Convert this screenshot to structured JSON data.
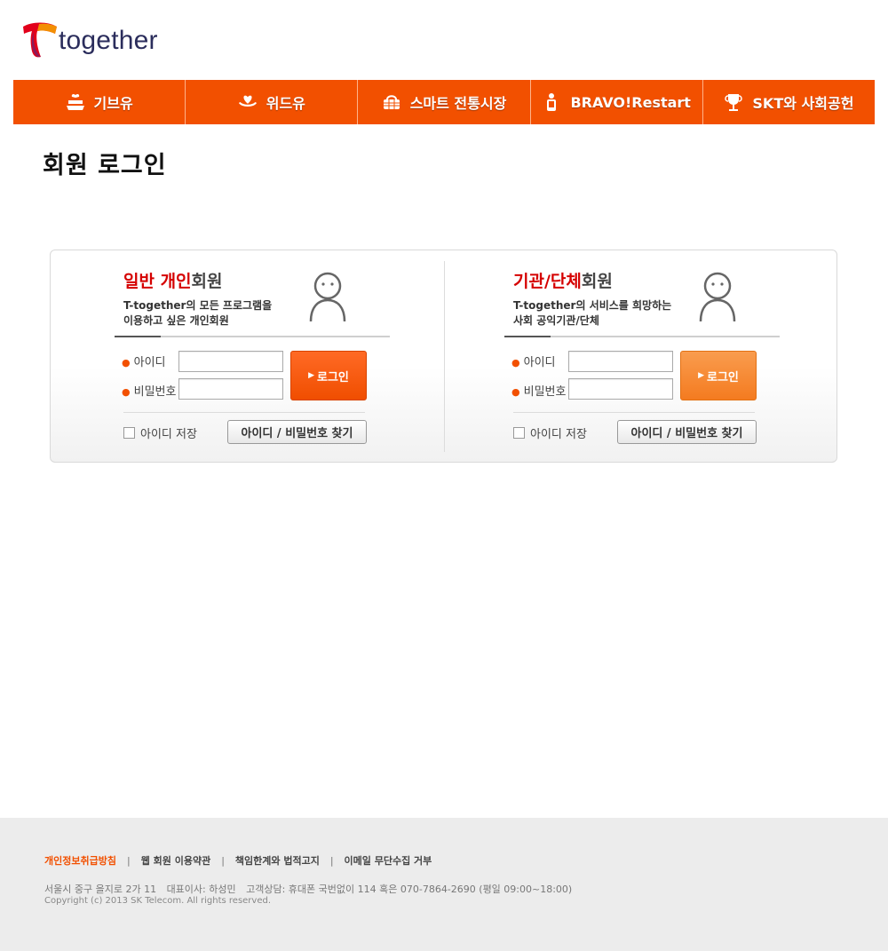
{
  "brand": {
    "logo_text": "together",
    "colors": {
      "primary": "#f25000",
      "logo_red": "#e2001a",
      "logo_yellow": "#f6a800",
      "logo_navy": "#2b2d5c"
    }
  },
  "nav": {
    "items": [
      {
        "label": "기브유",
        "icon": "gift-icon"
      },
      {
        "label": "위드유",
        "icon": "hands-heart-icon"
      },
      {
        "label": "스마트 전통시장",
        "icon": "basket-icon"
      },
      {
        "label": "BRAVO!Restart",
        "icon": "person-phone-icon"
      },
      {
        "label": "SKT와 사회공헌",
        "icon": "trophy-icon"
      }
    ]
  },
  "page": {
    "title": "회원 로그인"
  },
  "login": {
    "personal": {
      "heading_red": "일반 개인",
      "heading_rest": "회원",
      "desc_line1": "T-together의 모든 프로그램을",
      "desc_line2": "이용하고 싶은 개인회원",
      "id_label": "아이디",
      "pw_label": "비밀번호",
      "id_value": "",
      "pw_value": "",
      "login_label": "로그인",
      "save_id_label": "아이디 저장",
      "find_label": "아이디 / 비밀번호 찾기"
    },
    "group": {
      "heading_red": "기관/단체",
      "heading_rest": "회원",
      "desc_line1": "T-together의 서비스를 희망하는",
      "desc_line2": "사회 공익기관/단체",
      "id_label": "아이디",
      "pw_label": "비밀번호",
      "id_value": "",
      "pw_value": "",
      "login_label": "로그인",
      "save_id_label": "아이디 저장",
      "find_label": "아이디 / 비밀번호 찾기"
    }
  },
  "footer": {
    "links": [
      {
        "label": "개인정보취급방침",
        "highlight": true
      },
      {
        "label": "웹 회원 이용약관",
        "highlight": false
      },
      {
        "label": "책임한계와 법적고지",
        "highlight": false
      },
      {
        "label": "이메일 무단수집 거부",
        "highlight": false
      }
    ],
    "separator": "|",
    "address": "서울시 중구 을지로 2가 11",
    "ceo": "대표이사: 하성민",
    "support": "고객상담: 휴대폰 국번없이 114 혹은 070-7864-2690 (평일 09:00~18:00)",
    "copyright": "Copyright (c) 2013 SK Telecom. All rights reserved."
  }
}
